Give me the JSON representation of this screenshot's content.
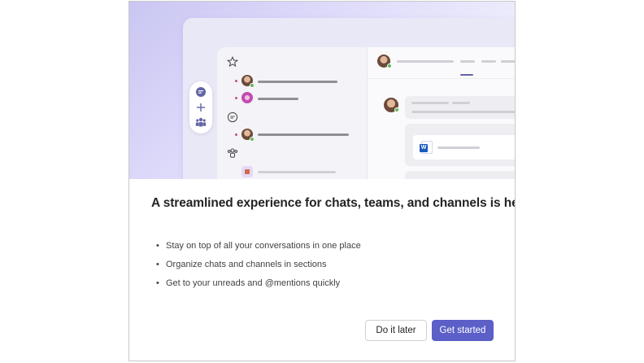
{
  "dialog": {
    "title": "A streamlined experience for chats, teams, and channels is here",
    "bullets": [
      "Stay on top of all your conversations in one place",
      "Organize chats and channels in sections",
      "Get to your unreads and @mentions quickly"
    ],
    "secondary_button": "Do it later",
    "primary_button": "Get started"
  },
  "illustration": {
    "icons": [
      "chat-icon",
      "plus-icon",
      "teams-icon",
      "star-icon",
      "chat-bubble-icon",
      "teams-group-icon",
      "word-file-icon"
    ]
  },
  "colors": {
    "accent": "#5b5fc7",
    "illustration_bg": "#ddd9fa",
    "presence": "#5fb85a",
    "word": "#185abd"
  }
}
